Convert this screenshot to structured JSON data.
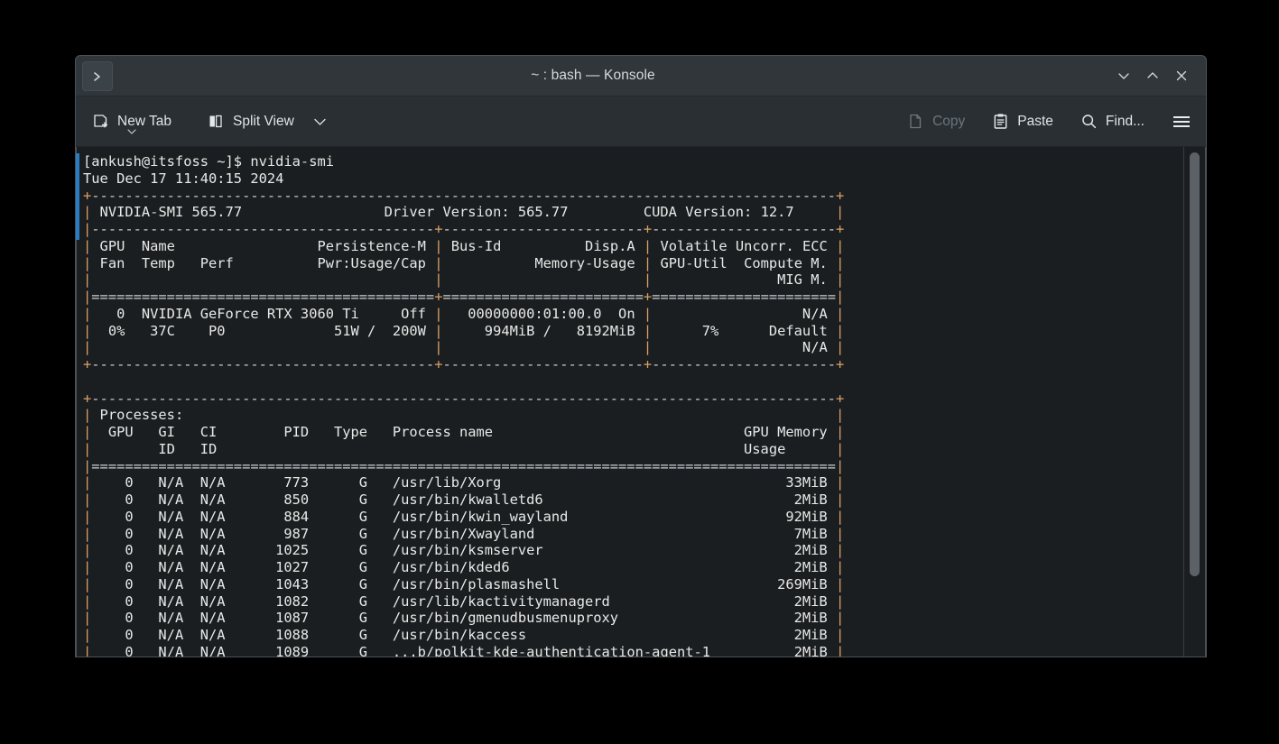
{
  "window": {
    "title": "~ : bash — Konsole",
    "tab_icon": "terminal-prompt-icon",
    "controls": {
      "minimize_label": "Minimize",
      "maximize_label": "Maximize",
      "close_label": "Close"
    }
  },
  "toolbar": {
    "new_tab_label": "New Tab",
    "split_view_label": "Split View",
    "copy_label": "Copy",
    "paste_label": "Paste",
    "find_label": "Find...",
    "menu_label": "Menu"
  },
  "terminal": {
    "prompt_line": "[ankush@itsfoss ~]$ nvidia-smi",
    "user": "ankush",
    "host": "itsfoss",
    "cwd": "~",
    "command": "nvidia-smi",
    "timestamp": "Tue Dec 17 11:40:15 2024",
    "nvidia_smi": {
      "smi_version_label": "NVIDIA-SMI 565.77",
      "driver_version_label": "Driver Version: 565.77",
      "cuda_version_label": "CUDA Version: 12.7",
      "gpu_table_headers_row1": [
        "GPU",
        "Name",
        "Persistence-M",
        "Bus-Id",
        "Disp.A",
        "Volatile Uncorr. ECC"
      ],
      "gpu_table_headers_row2": [
        "Fan",
        "Temp",
        "Perf",
        "Pwr:Usage/Cap",
        "Memory-Usage",
        "GPU-Util",
        "Compute M."
      ],
      "gpu_table_headers_row3": [
        "MIG M."
      ],
      "gpus": [
        {
          "index": "0",
          "name": "NVIDIA GeForce RTX 3060 Ti",
          "persistence_m": "Off",
          "bus_id": "00000000:01:00.0",
          "disp_a": "On",
          "ecc": "N/A",
          "fan": "0%",
          "temp": "37C",
          "perf": "P0",
          "pwr_usage": "51W",
          "pwr_cap": "200W",
          "memory_used": "994MiB",
          "memory_total": "8192MiB",
          "gpu_util": "7%",
          "compute_m": "Default",
          "mig_m": "N/A"
        }
      ],
      "processes_title": "Processes:",
      "process_headers_row1": [
        "GPU",
        "GI",
        "CI",
        "PID",
        "Type",
        "Process name",
        "GPU Memory"
      ],
      "process_headers_row2": [
        "ID",
        "ID",
        "Usage"
      ],
      "processes": [
        {
          "gpu": "0",
          "gi_id": "N/A",
          "ci_id": "N/A",
          "pid": "773",
          "type": "G",
          "name": "/usr/lib/Xorg",
          "memory": "33MiB"
        },
        {
          "gpu": "0",
          "gi_id": "N/A",
          "ci_id": "N/A",
          "pid": "850",
          "type": "G",
          "name": "/usr/bin/kwalletd6",
          "memory": "2MiB"
        },
        {
          "gpu": "0",
          "gi_id": "N/A",
          "ci_id": "N/A",
          "pid": "884",
          "type": "G",
          "name": "/usr/bin/kwin_wayland",
          "memory": "92MiB"
        },
        {
          "gpu": "0",
          "gi_id": "N/A",
          "ci_id": "N/A",
          "pid": "987",
          "type": "G",
          "name": "/usr/bin/Xwayland",
          "memory": "7MiB"
        },
        {
          "gpu": "0",
          "gi_id": "N/A",
          "ci_id": "N/A",
          "pid": "1025",
          "type": "G",
          "name": "/usr/bin/ksmserver",
          "memory": "2MiB"
        },
        {
          "gpu": "0",
          "gi_id": "N/A",
          "ci_id": "N/A",
          "pid": "1027",
          "type": "G",
          "name": "/usr/bin/kded6",
          "memory": "2MiB"
        },
        {
          "gpu": "0",
          "gi_id": "N/A",
          "ci_id": "N/A",
          "pid": "1043",
          "type": "G",
          "name": "/usr/bin/plasmashell",
          "memory": "269MiB"
        },
        {
          "gpu": "0",
          "gi_id": "N/A",
          "ci_id": "N/A",
          "pid": "1082",
          "type": "G",
          "name": "/usr/lib/kactivitymanagerd",
          "memory": "2MiB"
        },
        {
          "gpu": "0",
          "gi_id": "N/A",
          "ci_id": "N/A",
          "pid": "1087",
          "type": "G",
          "name": "/usr/bin/gmenudbusmenuproxy",
          "memory": "2MiB"
        },
        {
          "gpu": "0",
          "gi_id": "N/A",
          "ci_id": "N/A",
          "pid": "1088",
          "type": "G",
          "name": "/usr/bin/kaccess",
          "memory": "2MiB"
        },
        {
          "gpu": "0",
          "gi_id": "N/A",
          "ci_id": "N/A",
          "pid": "1089",
          "type": "G",
          "name": "...b/polkit-kde-authentication-agent-1",
          "memory": "2MiB"
        }
      ]
    },
    "raw_output": "[ankush@itsfoss ~]$ nvidia-smi\nTue Dec 17 11:40:15 2024\n+-----------------------------------------------------------------------------------------+\n| NVIDIA-SMI 565.77                 Driver Version: 565.77         CUDA Version: 12.7     |\n|-----------------------------------------+------------------------+----------------------+\n| GPU  Name                 Persistence-M | Bus-Id          Disp.A | Volatile Uncorr. ECC |\n| Fan  Temp   Perf          Pwr:Usage/Cap |           Memory-Usage | GPU-Util  Compute M. |\n|                                         |                        |               MIG M. |\n|=========================================+========================+======================|\n|   0  NVIDIA GeForce RTX 3060 Ti     Off |   00000000:01:00.0  On |                  N/A |\n|  0%   37C    P0             51W /  200W |     994MiB /   8192MiB |      7%      Default |\n|                                         |                        |                  N/A |\n+-----------------------------------------+------------------------+----------------------+\n                                                                                         \n+-----------------------------------------------------------------------------------------+\n| Processes:                                                                              |\n|  GPU   GI   CI        PID   Type   Process name                              GPU Memory |\n|        ID   ID                                                               Usage      |\n|=========================================================================================|\n|    0   N/A  N/A       773      G   /usr/lib/Xorg                                  33MiB |\n|    0   N/A  N/A       850      G   /usr/bin/kwalletd6                              2MiB |\n|    0   N/A  N/A       884      G   /usr/bin/kwin_wayland                          92MiB |\n|    0   N/A  N/A       987      G   /usr/bin/Xwayland                               7MiB |\n|    0   N/A  N/A      1025      G   /usr/bin/ksmserver                              2MiB |\n|    0   N/A  N/A      1027      G   /usr/bin/kded6                                  2MiB |\n|    0   N/A  N/A      1043      G   /usr/bin/plasmashell                          269MiB |\n|    0   N/A  N/A      1082      G   /usr/lib/kactivitymanagerd                      2MiB |\n|    0   N/A  N/A      1087      G   /usr/bin/gmenudbusmenuproxy                     2MiB |\n|    0   N/A  N/A      1088      G   /usr/bin/kaccess                                2MiB |\n|    0   N/A  N/A      1089      G   ...b/polkit-kde-authentication-agent-1          2MiB |"
  },
  "colors": {
    "desktop_background": "#000000",
    "titlebar_background": "#31363b",
    "toolbar_background": "#2a2f34",
    "terminal_background": "#1b1e20",
    "terminal_foreground": "#e8e8e8",
    "table_rule_color": "#d9a066",
    "command_marker_blue": "#2a7bc0",
    "scrollbar_thumb": "#5b6167"
  }
}
